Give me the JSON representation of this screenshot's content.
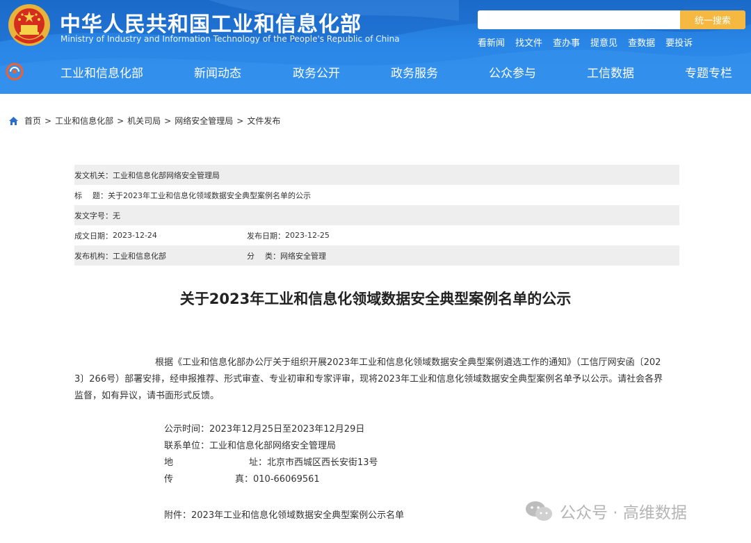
{
  "header": {
    "title": "中华人民共和国工业和信息化部",
    "subtitle": "Ministry of Industry and Information Technology of the People's Republic of China",
    "search_placeholder": "",
    "search_button": "统一搜索",
    "quick_links": [
      "看新闻",
      "找文件",
      "查办事",
      "提意见",
      "查数据",
      "要投诉"
    ],
    "brand_color": "#2a86e6",
    "accent_color": "#f5b942"
  },
  "nav": {
    "items": [
      "工业和信息化部",
      "新闻动态",
      "政务公开",
      "政务服务",
      "公众参与",
      "工信数据",
      "专题专栏"
    ]
  },
  "breadcrumb": {
    "items": [
      "首页",
      "工业和信息化部",
      "机关司局",
      "网络安全管理局",
      "文件发布"
    ],
    "separator": ">"
  },
  "info": {
    "issuer_label": "发文机关：",
    "issuer_value": "工业和信息化部网络安全管理局",
    "title_label_a": "标",
    "title_label_b": "题：",
    "title_value": "关于2023年工业和信息化领域数据安全典型案例名单的公示",
    "doc_no_label": "发文字号：",
    "doc_no_value": "无",
    "created_label": "成文日期：",
    "created_value": "2023-12-24",
    "published_label": "发布日期：",
    "published_value": "2023-12-25",
    "org_label": "发布机构：",
    "org_value": "工业和信息化部",
    "category_label_a": "分",
    "category_label_b": "类：",
    "category_value": "网络安全管理"
  },
  "article": {
    "title": "关于2023年工业和信息化领域数据安全典型案例名单的公示",
    "para_line1": "根据《工业和信息化部办公厅关于组织开展2023年工业和信息化领域数据安全典型案例遴选工作的通知》（工信厅网安函〔202",
    "para_line2": "3〕266号）部署安排，经申报推荐、形式审查、专业初审和专家评审，现将2023年工业和信息化领域数据安全典型案例名单予以公示。请社会各界",
    "para_line3": "监督，如有异议，请书面形式反馈。",
    "notice_period_label": "公示时间：",
    "notice_period_value": "2023年12月25日至2023年12月29日",
    "contact_label": "联系单位：",
    "contact_value": "工业和信息化部网络安全管理局",
    "address_label_a": "地",
    "address_label_b": "址：",
    "address_value": "北京市西城区西长安街13号",
    "fax_label_a": "传",
    "fax_label_b": "真：",
    "fax_value": "010-66069561",
    "attachment": "附件：2023年工业和信息化领域数据安全典型案例公示名单"
  },
  "watermark": {
    "text": "公众号 · 高维数据"
  }
}
